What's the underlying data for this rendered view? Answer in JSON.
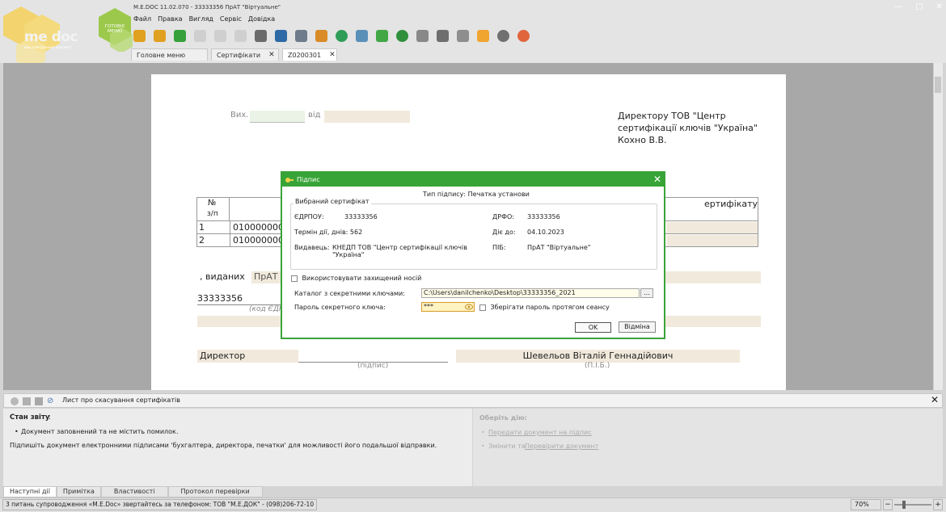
{
  "app": {
    "brand": "me doc",
    "brand_sub": "ваш електронний документ",
    "green_label": "ГОТОВІЄ МЕНЮ",
    "title": "M.E.DOC 11.02.070 - 33333356 ПрАТ \"Віртуальне\"",
    "window_controls": [
      "—",
      "□",
      "✕"
    ]
  },
  "menu": [
    "Файл",
    "Правка",
    "Вигляд",
    "Сервіс",
    "Довідка"
  ],
  "toolbar": {
    "icons": [
      "folder-add-icon",
      "folder-remove-icon",
      "save-icon",
      "document-add-icon",
      "document-edit-icon",
      "document-delete-icon",
      "cursor-icon",
      "stamp-icon",
      "print-icon",
      "package-icon",
      "send-icon",
      "search-icon",
      "check-icon",
      "refresh-icon",
      "layers-icon",
      "archive-icon",
      "gear-icon",
      "help-icon",
      "chat-icon",
      "notify-icon"
    ],
    "colors": [
      "#e0a020",
      "#e0a020",
      "#36a03a",
      "#cfcfcf",
      "#cfcfcf",
      "#cfcfcf",
      "#6a6a6a",
      "#2d6aa6",
      "#6d7b8a",
      "#d98b27",
      "#2f9d58",
      "#5a8fb8",
      "#41a745",
      "#2f8f3a",
      "#888888",
      "#6e6e6e",
      "#8e8e8e",
      "#f0a531",
      "#707070",
      "#e0653d"
    ]
  },
  "tabs": [
    {
      "label": "Головне меню",
      "close": ""
    },
    {
      "label": "Сертифікати",
      "close": "✕"
    },
    {
      "label": "Z0200301",
      "close": "✕"
    }
  ],
  "document": {
    "out_label": "Вих.",
    "from_label": "від",
    "recipient_1": "Директору ТОВ \"Центр",
    "recipient_2": "сертифікації ключів \"Україна\"",
    "recipient_3": "Кохно В.В.",
    "table": {
      "header_num": "№",
      "header_num2": "з/п",
      "header_cert": "ертифікату",
      "rows": [
        {
          "n": "1",
          "code": "010000000"
        },
        {
          "n": "2",
          "code": "010000000"
        }
      ]
    },
    "issued_label": ", виданих",
    "issued_value": "ПрАТ",
    "edrpou": "33333356",
    "edrpou_caption": "(код ЄДР",
    "director_label": "Директор",
    "signature_caption": "(підпис)",
    "director_name": "Шевельов Віталій Геннадійович",
    "name_caption": "(П.І.Б.)"
  },
  "dialog": {
    "title": "Підпис",
    "close": "✕",
    "signature_type": "Тип підпису: Печатка установи",
    "group_label": "Вибраний сертифікат",
    "edrpou_label": "ЄДРПОУ:",
    "edrpou_value": "33333356",
    "drfo_label": "ДРФО:",
    "drfo_value": "33333356",
    "term_label": "Термін дії, днів: 562",
    "valid_label": "Діє до:",
    "valid_value": "04.10.2023",
    "issuer_label": "Видавець:",
    "issuer_value_1": "КНЕДП ТОВ \"Центр сертифікації ключів",
    "issuer_value_2": "\"Україна\"",
    "pib_label": "ПІБ:",
    "pib_value": "ПрАТ \"Віртуальне\"",
    "protected_media": "Використовувати захищений носій",
    "keys_dir_label": "Каталог з секретними ключами:",
    "keys_dir_value": "C:\\Users\\danilchenko\\Desktop\\33333356_2021",
    "browse": "...",
    "password_label": "Пароль секретного ключа:",
    "password_value": "***",
    "save_password": "Зберігати пароль протягом сеансу",
    "ok": "OK",
    "cancel": "Відміна"
  },
  "panel": {
    "title": "Лист про скасування сертифікатів",
    "close": "✕",
    "status_heading": "Стан звіту",
    "status_line": "Документ заповнений та не містить помилок.",
    "hint": "Підпишіть документ електронними підписами 'бухгалтера, директора, печатки' для можливості його подальшої відправки.",
    "choose_heading": "Оберіть дію:",
    "action_1": "Передати документ на підпис",
    "action_2a": "Змінити та",
    "action_2b": "Перевірити документ"
  },
  "bottom_tabs": [
    "Наступні дії",
    "Примітка",
    "Властивості",
    "Протокол перевірки"
  ],
  "statusbar": {
    "support": "3 питань супроводження «M.E.Doc» звертайтесь за телефоном: ТОВ \"М.Е.ДОК\" - (098)206-72-10",
    "zoom": "70%",
    "zoom_level": 0.7,
    "minus": "−",
    "plus": "+"
  }
}
